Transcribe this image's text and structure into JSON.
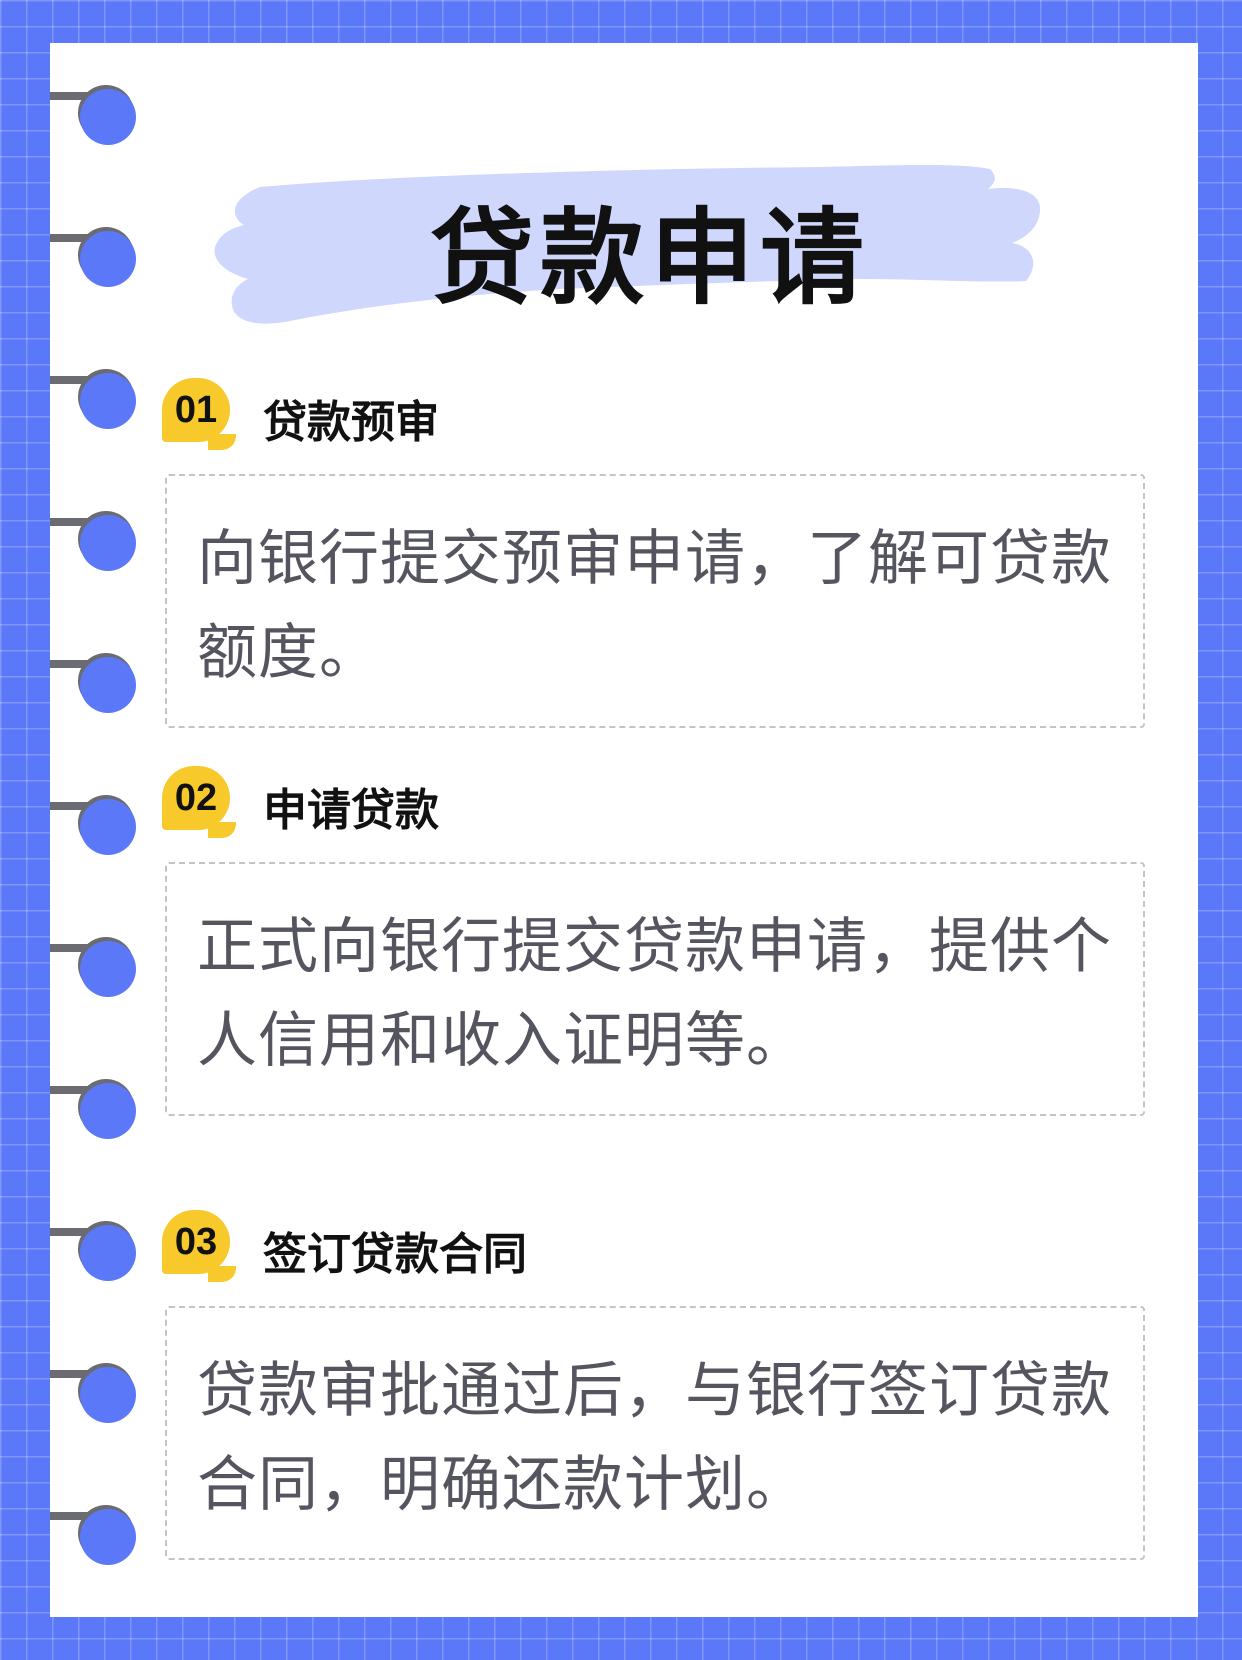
{
  "title": "贷款申请",
  "colors": {
    "background": "#5b78f8",
    "paper": "#ffffff",
    "title_highlight": "#cfd8fc",
    "badge": "#f8c92b",
    "heading_text": "#111111",
    "body_text": "#555560",
    "ring_bar": "#6b6b72"
  },
  "steps": [
    {
      "number": "01",
      "heading": "贷款预审",
      "text": "向银行提交预审申请，了解可贷款额度。"
    },
    {
      "number": "02",
      "heading": "申请贷款",
      "text": "正式向银行提交贷款申请，提供个人信用和收入证明等。"
    },
    {
      "number": "03",
      "heading": "签订贷款合同",
      "text": "贷款审批通过后，与银行签订贷款合同，明确还款计划。"
    }
  ]
}
